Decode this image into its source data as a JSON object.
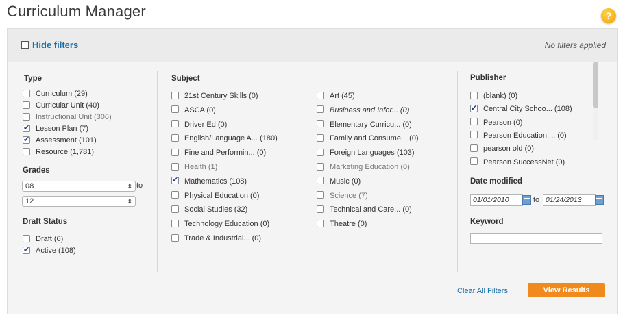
{
  "header": {
    "title": "Curriculum Manager",
    "help_icon": "?"
  },
  "filter_bar": {
    "toggle_label": "Hide filters",
    "status": "No filters applied"
  },
  "type": {
    "heading": "Type",
    "items": [
      {
        "label": "Curriculum  (29)",
        "checked": false,
        "gray": false
      },
      {
        "label": "Curricular Unit  (40)",
        "checked": false,
        "gray": false
      },
      {
        "label": "Instructional Unit  (306)",
        "checked": false,
        "gray": true
      },
      {
        "label": "Lesson Plan  (7)",
        "checked": true,
        "gray": false
      },
      {
        "label": "Assessment  (101)",
        "checked": true,
        "gray": false
      },
      {
        "label": "Resource  (1,781)",
        "checked": false,
        "gray": false
      }
    ]
  },
  "grades": {
    "heading": "Grades",
    "from": "08",
    "to_label": "to",
    "to": "12"
  },
  "draft_status": {
    "heading": "Draft Status",
    "items": [
      {
        "label": "Draft  (6)",
        "checked": false
      },
      {
        "label": "Active  (108)",
        "checked": true
      }
    ]
  },
  "subject": {
    "heading": "Subject",
    "col1": [
      {
        "label": "21st Century Skills  (0)",
        "checked": false,
        "gray": false,
        "italic": false
      },
      {
        "label": "ASCA  (0)",
        "checked": false,
        "gray": false,
        "italic": false
      },
      {
        "label": "Driver Ed  (0)",
        "checked": false,
        "gray": false,
        "italic": false
      },
      {
        "label": "English/Language A...  (180)",
        "checked": false,
        "gray": false,
        "italic": false
      },
      {
        "label": "Fine and Performin...  (0)",
        "checked": false,
        "gray": false,
        "italic": false
      },
      {
        "label": "Health  (1)",
        "checked": false,
        "gray": true,
        "italic": false
      },
      {
        "label": "Mathematics  (108)",
        "checked": true,
        "gray": false,
        "italic": false
      },
      {
        "label": "Physical Education  (0)",
        "checked": false,
        "gray": false,
        "italic": false
      },
      {
        "label": "Social Studies  (32)",
        "checked": false,
        "gray": false,
        "italic": false
      },
      {
        "label": "Technology Education  (0)",
        "checked": false,
        "gray": false,
        "italic": false
      },
      {
        "label": "Trade & Industrial...  (0)",
        "checked": false,
        "gray": false,
        "italic": false
      }
    ],
    "col2": [
      {
        "label": "Art  (45)",
        "checked": false,
        "gray": false,
        "italic": false
      },
      {
        "label": "Business and Infor...  (0)",
        "checked": false,
        "gray": false,
        "italic": true
      },
      {
        "label": "Elementary Curricu...  (0)",
        "checked": false,
        "gray": false,
        "italic": false
      },
      {
        "label": "Family and Consume...  (0)",
        "checked": false,
        "gray": false,
        "italic": false
      },
      {
        "label": "Foreign Languages  (103)",
        "checked": false,
        "gray": false,
        "italic": false
      },
      {
        "label": "Marketing Education  (0)",
        "checked": false,
        "gray": true,
        "italic": false
      },
      {
        "label": "Music  (0)",
        "checked": false,
        "gray": false,
        "italic": false
      },
      {
        "label": "Science  (7)",
        "checked": false,
        "gray": true,
        "italic": false
      },
      {
        "label": "Technical and Care...  (0)",
        "checked": false,
        "gray": false,
        "italic": false
      },
      {
        "label": "Theatre  (0)",
        "checked": false,
        "gray": false,
        "italic": false
      }
    ]
  },
  "publisher": {
    "heading": "Publisher",
    "items": [
      {
        "label": "(blank)  (0)",
        "checked": false
      },
      {
        "label": "Central City Schoo...  (108)",
        "checked": true
      },
      {
        "label": "Pearson  (0)",
        "checked": false
      },
      {
        "label": "Pearson Education,...  (0)",
        "checked": false
      },
      {
        "label": "pearson old  (0)",
        "checked": false
      },
      {
        "label": "Pearson SuccessNet  (0)",
        "checked": false
      }
    ]
  },
  "date_modified": {
    "heading": "Date modified",
    "from": "01/01/2010",
    "to_label": "to",
    "to": "01/24/2013"
  },
  "keyword": {
    "heading": "Keyword",
    "value": ""
  },
  "actions": {
    "clear_label": "Clear All Filters",
    "view_label": "View Results"
  }
}
